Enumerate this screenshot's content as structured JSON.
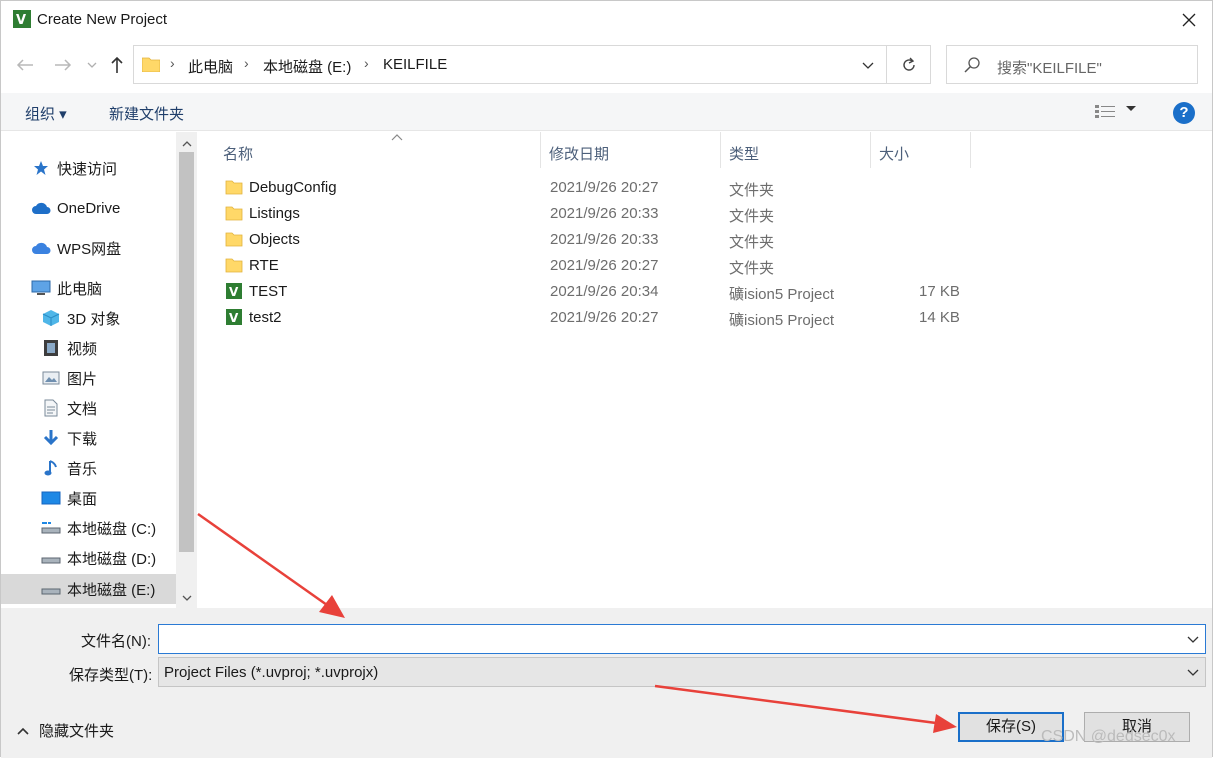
{
  "window": {
    "title": "Create New Project"
  },
  "address": {
    "crumbs": [
      "此电脑",
      "本地磁盘 (E:)",
      "KEILFILE"
    ],
    "search_placeholder": "搜索\"KEILFILE\""
  },
  "toolbar": {
    "organize": "组织 ▾",
    "new_folder": "新建文件夹",
    "help": "?"
  },
  "sidebar": {
    "items": [
      {
        "label": "快速访问",
        "icon": "star-icon"
      },
      {
        "label": "OneDrive",
        "icon": "cloud-icon"
      },
      {
        "label": "WPS网盘",
        "icon": "wps-cloud-icon"
      },
      {
        "label": "此电脑",
        "icon": "computer-icon"
      },
      {
        "label": "3D 对象",
        "icon": "cube-icon"
      },
      {
        "label": "视频",
        "icon": "film-icon"
      },
      {
        "label": "图片",
        "icon": "picture-icon"
      },
      {
        "label": "文档",
        "icon": "document-icon"
      },
      {
        "label": "下载",
        "icon": "download-icon"
      },
      {
        "label": "音乐",
        "icon": "music-icon"
      },
      {
        "label": "桌面",
        "icon": "desktop-icon"
      },
      {
        "label": "本地磁盘 (C:)",
        "icon": "drive-icon"
      },
      {
        "label": "本地磁盘 (D:)",
        "icon": "drive-icon"
      },
      {
        "label": "本地磁盘 (E:)",
        "icon": "drive-icon",
        "selected": true
      }
    ]
  },
  "columns": {
    "name": "名称",
    "modified": "修改日期",
    "type": "类型",
    "size": "大小"
  },
  "files": [
    {
      "name": "DebugConfig",
      "date": "2021/9/26 20:27",
      "type": "文件夹",
      "size": "",
      "icon": "folder-icon"
    },
    {
      "name": "Listings",
      "date": "2021/9/26 20:33",
      "type": "文件夹",
      "size": "",
      "icon": "folder-icon"
    },
    {
      "name": "Objects",
      "date": "2021/9/26 20:33",
      "type": "文件夹",
      "size": "",
      "icon": "folder-icon"
    },
    {
      "name": "RTE",
      "date": "2021/9/26 20:27",
      "type": "文件夹",
      "size": "",
      "icon": "folder-icon"
    },
    {
      "name": "TEST",
      "date": "2021/9/26 20:34",
      "type": "礦ision5 Project",
      "size": "17 KB",
      "icon": "uvision-project-icon"
    },
    {
      "name": "test2",
      "date": "2021/9/26 20:27",
      "type": "礦ision5 Project",
      "size": "14 KB",
      "icon": "uvision-project-icon"
    }
  ],
  "form": {
    "filename_label": "文件名(N):",
    "filename_value": "",
    "filetype_label": "保存类型(T):",
    "filetype_value": "Project Files (*.uvproj; *.uvprojx)"
  },
  "footer": {
    "hide_folders": "隐藏文件夹",
    "save": "保存(S)",
    "cancel": "取消",
    "watermark": "CSDN @dedsec0x"
  },
  "colors": {
    "accent": "#1a6fc9",
    "arrow": "#e8413a",
    "folder": "#ffd868"
  }
}
